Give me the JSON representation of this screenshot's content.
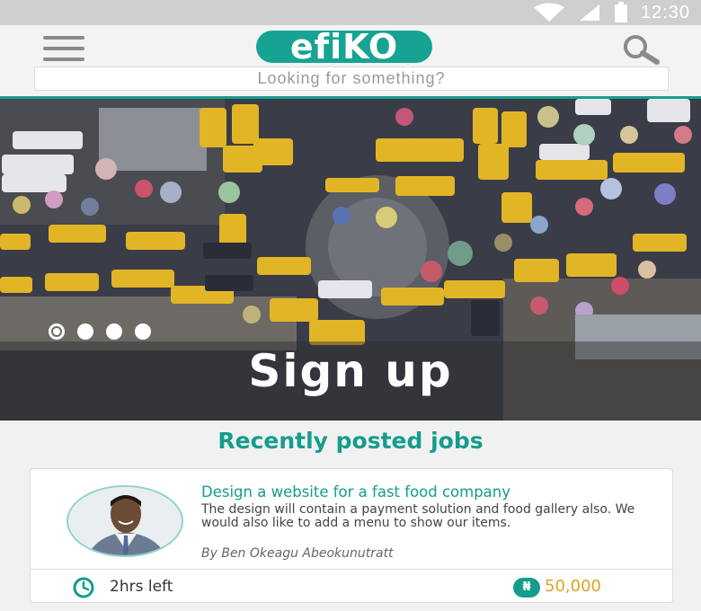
{
  "status_bar": {
    "time": "12:30",
    "icons": [
      "wifi-icon",
      "signal-icon",
      "battery-icon"
    ]
  },
  "header": {
    "logo_text": "efiKO",
    "search_placeholder": "Looking for something?",
    "icons": [
      "menu-icon",
      "search-icon"
    ]
  },
  "hero": {
    "cta_label": "Sign up",
    "slides_total": 4,
    "slide_active": 1
  },
  "jobs_section": {
    "title": "Recently posted jobs",
    "jobs": [
      {
        "title": "Design a website for a fast food company",
        "description": "The design will contain a payment solution and food gallery also. We would also like to add a menu to show our items.",
        "author": "By Ben Okeagu Abeokunutratt",
        "time_left": "2hrs left",
        "currency_symbol": "₦",
        "price": "50,000"
      }
    ]
  },
  "colors": {
    "accent": "#159c8d",
    "price": "#d9a426",
    "status_bar": "#cfcfcf"
  }
}
